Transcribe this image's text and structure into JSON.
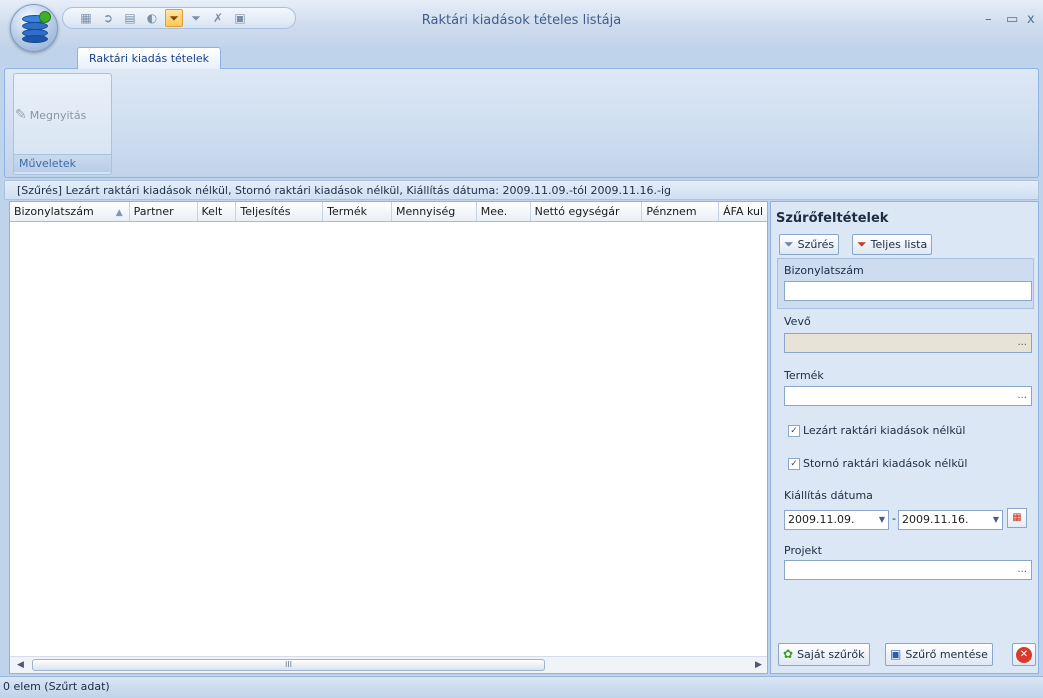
{
  "window": {
    "title": "Raktári kiadások tételes listája",
    "minimize": "–",
    "maximize": "▭",
    "close": "x"
  },
  "quick_access": [
    {
      "icon": "grid-icon"
    },
    {
      "icon": "export-icon"
    },
    {
      "icon": "print-icon"
    },
    {
      "icon": "chart-icon"
    },
    {
      "icon": "filter-icon",
      "active": true
    },
    {
      "icon": "filter-clear-icon"
    },
    {
      "icon": "filter-remove-icon"
    },
    {
      "icon": "list-icon"
    }
  ],
  "ribbon": {
    "tab": "Raktári kiadás tételek",
    "group_label": "Műveletek",
    "open_button": "Megnyitás"
  },
  "filter_bar": "[Szűrés]  Lezárt raktári kiadások nélkül, Stornó raktári kiadások nélkül, Kiállítás dátuma: 2009.11.09.-tól  2009.11.16.-ig",
  "grid": {
    "columns": [
      "Bizonylatszám",
      "Partner",
      "Kelt",
      "Teljesítés",
      "Termék",
      "Mennyiség",
      "Mee.",
      "Nettó egységár",
      "Pénznem",
      "ÁFA kul"
    ],
    "rows": [],
    "scroll_grip": "III"
  },
  "panel": {
    "title": "Szűrőfeltételek",
    "filter_button": "Szűrés",
    "full_list_button": "Teljes lista",
    "document_number_label": "Bizonylatszám",
    "document_number_value": "",
    "customer_label": "Vevő",
    "customer_value": "",
    "product_label": "Termék",
    "product_value": "",
    "closed_checkbox": {
      "label": "Lezárt raktári kiadások nélkül",
      "checked": true
    },
    "storno_checkbox": {
      "label": "Stornó raktári kiadások nélkül",
      "checked": true
    },
    "issue_date_label": "Kiállítás dátuma",
    "date_from": "2009.11.09.",
    "date_separator": "-",
    "date_to": "2009.11.16.",
    "project_label": "Projekt",
    "project_value": "",
    "my_filters_button": "Saját szűrők",
    "save_filter_button": "Szűrő mentése",
    "lookup_dots": "..."
  },
  "status": "0 elem (Szűrt adat)"
}
